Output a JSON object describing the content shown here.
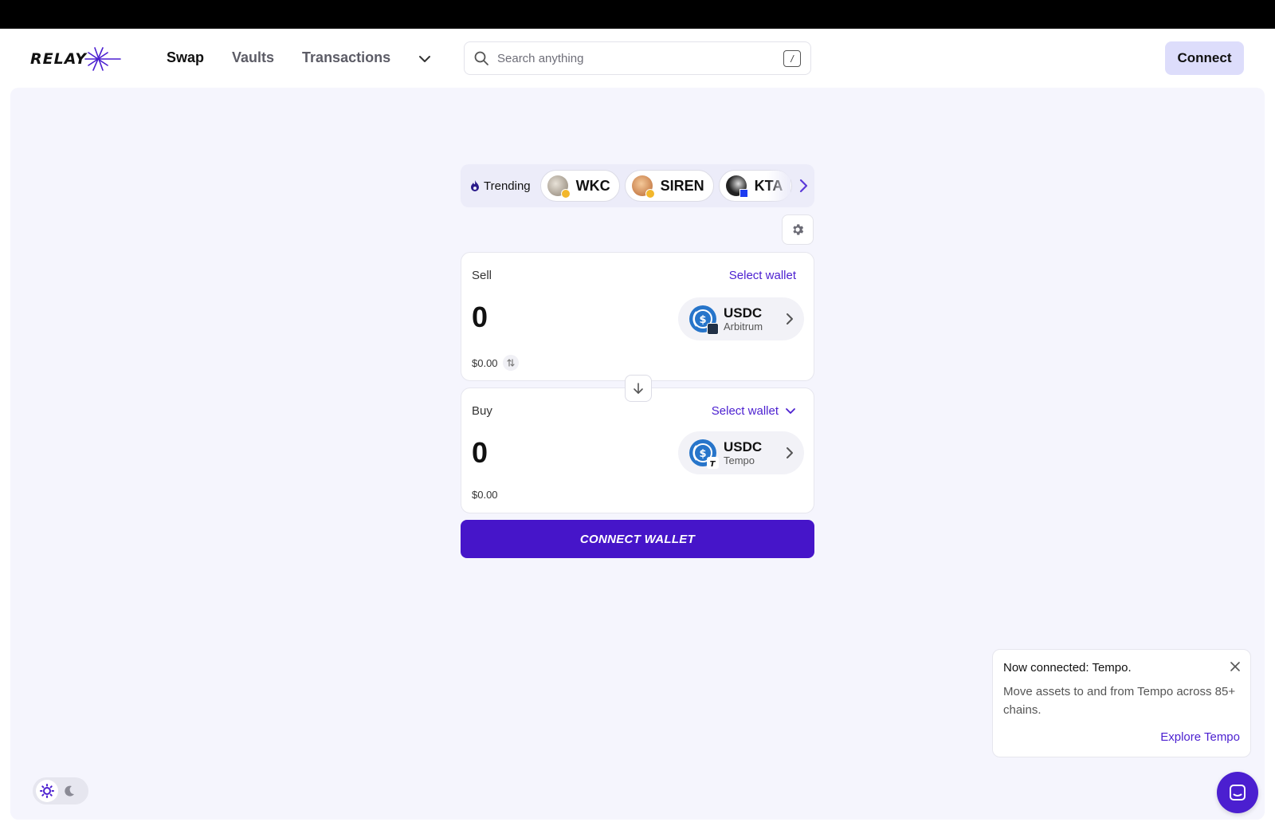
{
  "brand": {
    "logo_text": "RELAY",
    "accent": "#4615c9",
    "link_color": "#4b1fd0"
  },
  "nav": {
    "items": [
      {
        "label": "Swap",
        "active": true
      },
      {
        "label": "Vaults",
        "active": false
      },
      {
        "label": "Transactions",
        "active": false
      }
    ],
    "more_icon": "chevron-down-icon"
  },
  "search": {
    "placeholder": "Search anything",
    "shortcut": "/",
    "icon": "search-icon"
  },
  "header": {
    "connect_label": "Connect"
  },
  "trending": {
    "label": "Trending",
    "icon": "flame-icon",
    "tokens": [
      {
        "name": "WKC"
      },
      {
        "name": "SIREN"
      },
      {
        "name": "KTA"
      }
    ],
    "next_icon": "chevron-right-icon"
  },
  "swap": {
    "settings_icon": "gear-icon",
    "sell": {
      "label": "Sell",
      "wallet_label": "Select wallet",
      "amount": "0",
      "usd_value": "$0.00",
      "token_symbol": "USDC",
      "token_chain": "Arbitrum"
    },
    "buy": {
      "label": "Buy",
      "wallet_label": "Select wallet",
      "amount": "0",
      "usd_value": "$0.00",
      "token_symbol": "USDC",
      "token_chain": "Tempo"
    },
    "flip_icon": "arrow-down-icon",
    "cta_label": "CONNECT WALLET"
  },
  "toast": {
    "title": "Now connected: Tempo.",
    "body": "Move assets to and from Tempo across 85+ chains.",
    "link": "Explore Tempo"
  },
  "theme": {
    "options": [
      "light",
      "dark"
    ],
    "selected": "light"
  },
  "support": {
    "icon": "chat-icon"
  }
}
